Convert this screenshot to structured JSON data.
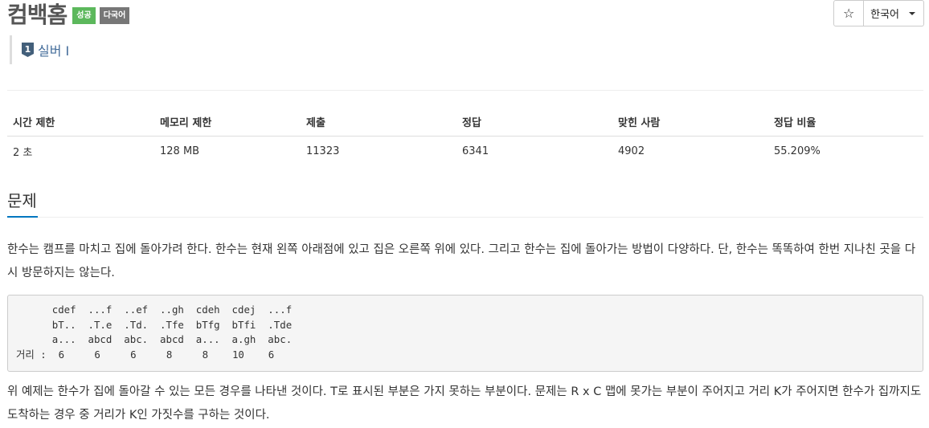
{
  "problem": {
    "title": "컴백홈",
    "badges": [
      {
        "label": "성공",
        "color": "#5cb85c"
      },
      {
        "label": "다국어",
        "color": "#777777"
      }
    ],
    "tier": {
      "icon": "silver-1-tier-icon",
      "level_digit": "1",
      "label": "실버 I",
      "color": "#436c9a"
    }
  },
  "toolbar": {
    "star_icon": "star-icon",
    "star_glyph": "☆",
    "language": "한국어"
  },
  "info_table": {
    "headers": [
      "시간 제한",
      "메모리 제한",
      "제출",
      "정답",
      "맞힌 사람",
      "정답 비율"
    ],
    "values": [
      "2 초",
      "128 MB",
      "11323",
      "6341",
      "4902",
      "55.209%"
    ]
  },
  "section": {
    "title": "문제",
    "accent": "#0076c0",
    "paragraph1": "한수는 캠프를 마치고 집에 돌아가려 한다. 한수는 현재 왼쪽 아래점에 있고 집은 오른쪽 위에 있다. 그리고 한수는 집에 돌아가는 방법이 다양하다. 단, 한수는 똑똑하여 한번 지나친 곳을 다시 방문하지는 않는다.",
    "example": "      cdef  ...f  ..ef  ..gh  cdeh  cdej  ...f  \n      bT..  .T.e  .Td.  .Tfe  bTfg  bTfi  .Tde  \n      a...  abcd  abc.  abcd  a...  a.gh  abc.  \n거리 :  6     6     6     8     8    10    6",
    "paragraph2": "위 예제는 한수가 집에 돌아갈 수 있는 모든 경우를 나타낸 것이다. T로 표시된 부분은 가지 못하는 부분이다. 문제는 R x C 맵에 못가는 부분이 주어지고 거리 K가 주어지면 한수가 집까지도 도착하는 경우 중 거리가 K인 가짓수를 구하는 것이다."
  }
}
